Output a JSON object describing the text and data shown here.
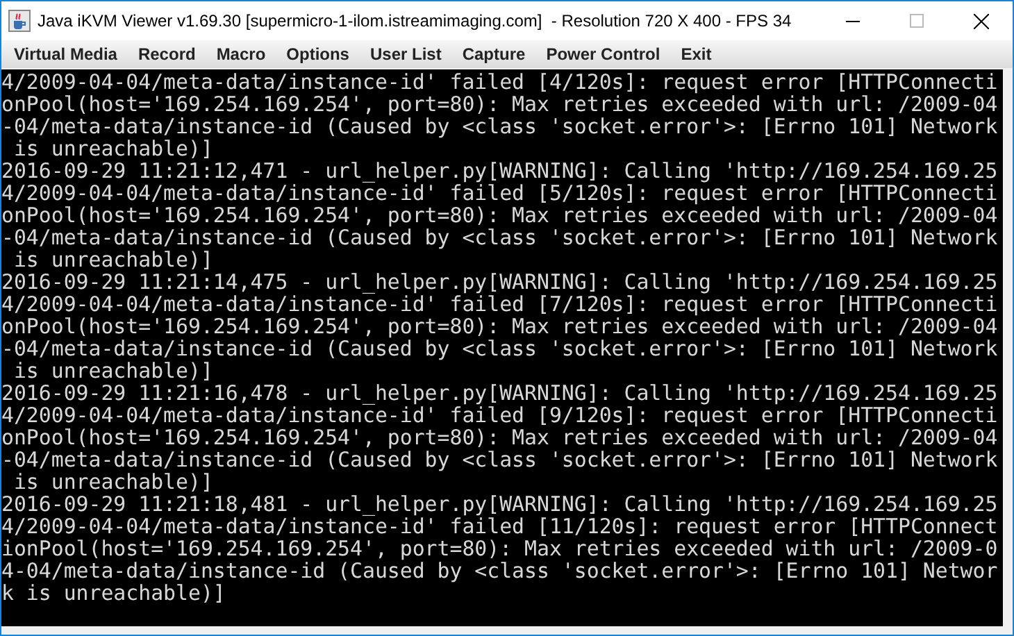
{
  "window": {
    "title": "Java iKVM Viewer v1.69.30 [supermicro-1-ilom.istreamimaging.com]  - Resolution 720 X 400 - FPS 34"
  },
  "menu": [
    "Virtual Media",
    "Record",
    "Macro",
    "Options",
    "User List",
    "Capture",
    "Power Control",
    "Exit"
  ],
  "console": {
    "lines": [
      "4/2009-04-04/meta-data/instance-id' failed [4/120s]: request error [HTTPConnecti",
      "onPool(host='169.254.169.254', port=80): Max retries exceeded with url: /2009-04",
      "-04/meta-data/instance-id (Caused by <class 'socket.error'>: [Errno 101] Network",
      " is unreachable)]",
      "2016-09-29 11:21:12,471 - url_helper.py[WARNING]: Calling 'http://169.254.169.25",
      "4/2009-04-04/meta-data/instance-id' failed [5/120s]: request error [HTTPConnecti",
      "onPool(host='169.254.169.254', port=80): Max retries exceeded with url: /2009-04",
      "-04/meta-data/instance-id (Caused by <class 'socket.error'>: [Errno 101] Network",
      " is unreachable)]",
      "2016-09-29 11:21:14,475 - url_helper.py[WARNING]: Calling 'http://169.254.169.25",
      "4/2009-04-04/meta-data/instance-id' failed [7/120s]: request error [HTTPConnecti",
      "onPool(host='169.254.169.254', port=80): Max retries exceeded with url: /2009-04",
      "-04/meta-data/instance-id (Caused by <class 'socket.error'>: [Errno 101] Network",
      " is unreachable)]",
      "2016-09-29 11:21:16,478 - url_helper.py[WARNING]: Calling 'http://169.254.169.25",
      "4/2009-04-04/meta-data/instance-id' failed [9/120s]: request error [HTTPConnecti",
      "onPool(host='169.254.169.254', port=80): Max retries exceeded with url: /2009-04",
      "-04/meta-data/instance-id (Caused by <class 'socket.error'>: [Errno 101] Network",
      " is unreachable)]",
      "2016-09-29 11:21:18,481 - url_helper.py[WARNING]: Calling 'http://169.254.169.25",
      "4/2009-04-04/meta-data/instance-id' failed [11/120s]: request error [HTTPConnect",
      "ionPool(host='169.254.169.254', port=80): Max retries exceeded with url: /2009-0",
      "4-04/meta-data/instance-id (Caused by <class 'socket.error'>: [Errno 101] Networ",
      "k is unreachable)]"
    ]
  }
}
